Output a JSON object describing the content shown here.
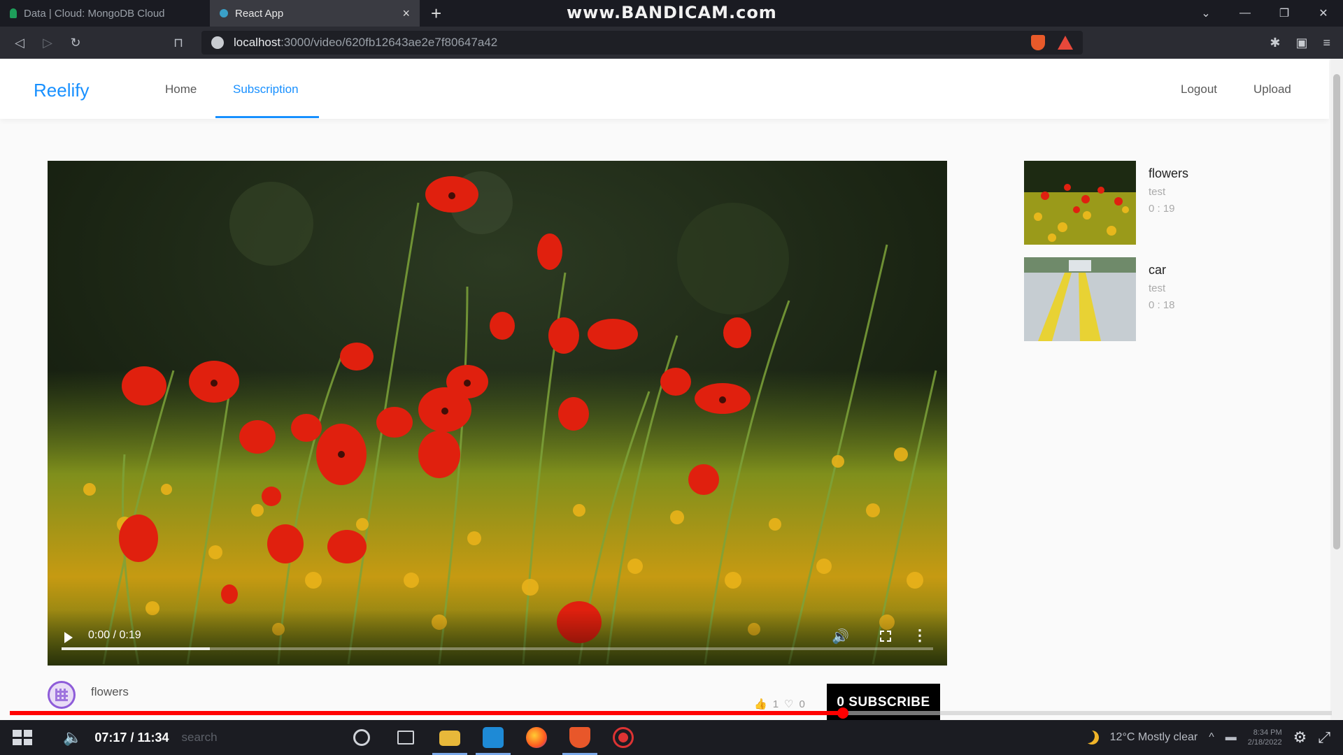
{
  "browser": {
    "tabs": [
      {
        "label": "Data | Cloud: MongoDB Cloud",
        "active": false,
        "icon": "mongodb-leaf-icon"
      },
      {
        "label": "React App",
        "active": true,
        "icon": "react-icon"
      }
    ],
    "new_tab": "+",
    "overlay_watermark": "www.BANDICAM.com",
    "url_host": "localhost",
    "url_path": ":3000/video/620fb12643ae2e7f80647a42"
  },
  "app": {
    "logo": "Reelify",
    "nav": {
      "home": "Home",
      "subscription": "Subscription",
      "active": "Subscription"
    },
    "nav_right": {
      "logout": "Logout",
      "upload": "Upload"
    },
    "accent_color": "#1890ff"
  },
  "video": {
    "time": "0:00 / 0:19",
    "progress": 0.17,
    "title": "flowers",
    "likes": "1",
    "dislikes": "0",
    "subscribe_label": "0 SUBSCRIBE"
  },
  "sidebar": {
    "videos": [
      {
        "title": "flowers",
        "description": "test",
        "duration": "0 : 19"
      },
      {
        "title": "car",
        "description": "test",
        "duration": "0 : 18"
      }
    ]
  },
  "recording": {
    "time": "07:17 / 11:34",
    "progress": 0.63
  },
  "taskbar": {
    "search_placeholder": "search",
    "weather": "12°C  Mostly clear",
    "clock_time": "8:34 PM",
    "clock_date": "2/18/2022"
  }
}
